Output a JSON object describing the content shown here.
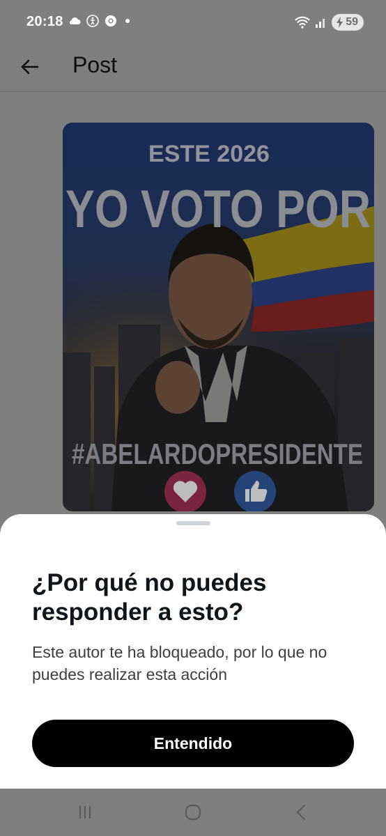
{
  "status_bar": {
    "time": "20:18",
    "left_icons": [
      "cloud-icon",
      "accessibility-icon",
      "chrome-icon",
      "dot-icon"
    ],
    "right_icons": [
      "wifi-icon",
      "signal-icon"
    ],
    "battery_level": "59"
  },
  "header": {
    "back_icon": "arrow-left-icon",
    "title": "Post"
  },
  "post": {
    "image_texts": {
      "line1": "ESTE 2026",
      "line2": "YO VOTO POR",
      "hashtag": "#ABELARDOPRESIDENTE"
    },
    "reaction_icons": [
      "heart-icon",
      "thumbs-up-icon"
    ]
  },
  "sheet": {
    "title": "¿Por qué no puedes responder a esto?",
    "body": "Este autor te ha bloqueado, por lo que no puedes realizar esta acción",
    "button_label": "Entendido"
  },
  "nav_bar": {
    "icons": [
      "recent-apps-icon",
      "home-icon",
      "back-nav-icon"
    ]
  }
}
